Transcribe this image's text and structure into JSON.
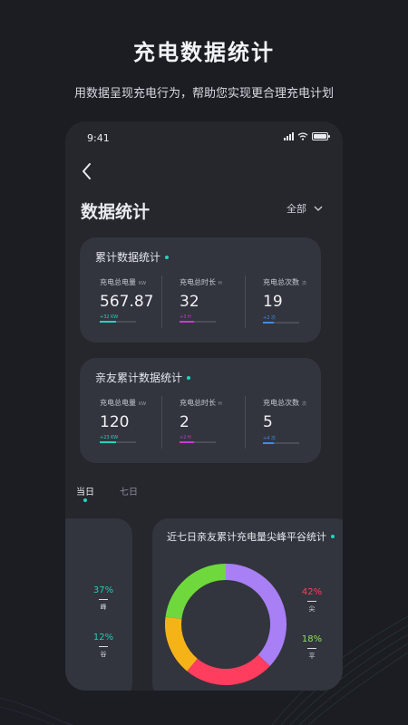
{
  "hero": {
    "title": "充电数据统计",
    "subtitle": "用数据呈现充电行为，帮助您实现更合理充电计划"
  },
  "status_bar": {
    "time": "9:41"
  },
  "header": {
    "title": "数据统计",
    "filter_label": "全部"
  },
  "cards": [
    {
      "title": "累计数据统计",
      "stats": [
        {
          "label": "充电总电量",
          "unit": "KW",
          "value": "567.87",
          "delta": "+32 KW",
          "color": "#25d2c0",
          "progress": 0.45
        },
        {
          "label": "充电总时长",
          "unit": "H",
          "value": "32",
          "delta": "+3 H",
          "color": "#c63bd2",
          "progress": 0.4
        },
        {
          "label": "充电总次数",
          "unit": "次",
          "value": "19",
          "delta": "+2 次",
          "color": "#3d8cf0",
          "progress": 0.3
        }
      ]
    },
    {
      "title": "亲友累计数据统计",
      "stats": [
        {
          "label": "充电总电量",
          "unit": "KW",
          "value": "120",
          "delta": "+23 KW",
          "color": "#25d2c0",
          "progress": 0.45
        },
        {
          "label": "充电总时长",
          "unit": "H",
          "value": "2",
          "delta": "+2 H",
          "color": "#c63bd2",
          "progress": 0.4
        },
        {
          "label": "充电总次数",
          "unit": "次",
          "value": "5",
          "delta": "+4 次",
          "color": "#3d8cf0",
          "progress": 0.3
        }
      ]
    }
  ],
  "tabs": [
    {
      "label": "当日",
      "active": true
    },
    {
      "label": "七日",
      "active": false
    }
  ],
  "left_panel": {
    "items": [
      {
        "percent": "37%",
        "label": "峰",
        "color": "#25c9b8"
      },
      {
        "percent": "12%",
        "label": "谷",
        "color": "#25c9b8"
      }
    ]
  },
  "right_panel": {
    "title": "近七日亲友累计充电量尖峰平谷统计",
    "legend": [
      {
        "percent": "42%",
        "label": "尖",
        "color": "#ff3d5e"
      },
      {
        "percent": "18%",
        "label": "平",
        "color": "#8fe05a"
      }
    ]
  },
  "donut": {
    "segments": [
      {
        "color": "#a87ff5",
        "fraction": 0.37
      },
      {
        "color": "#ff3d5e",
        "fraction": 0.24
      },
      {
        "color": "#f5b318",
        "fraction": 0.16
      },
      {
        "color": "#6fd83c",
        "fraction": 0.23
      }
    ]
  },
  "colors": {
    "accent": "#25d2c0",
    "background": "#1b1d23",
    "card": "#32353d"
  }
}
